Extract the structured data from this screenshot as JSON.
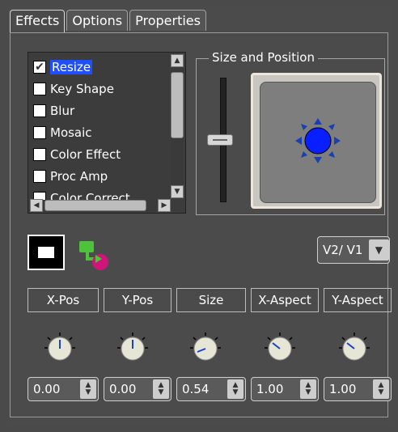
{
  "tabs": [
    {
      "label": "Effects",
      "active": true
    },
    {
      "label": "Options",
      "active": false
    },
    {
      "label": "Properties",
      "active": false
    }
  ],
  "effects": [
    {
      "label": "Resize",
      "checked": true,
      "selected": true
    },
    {
      "label": "Key Shape",
      "checked": false,
      "selected": false
    },
    {
      "label": "Blur",
      "checked": false,
      "selected": false
    },
    {
      "label": "Mosaic",
      "checked": false,
      "selected": false
    },
    {
      "label": "Color Effect",
      "checked": false,
      "selected": false
    },
    {
      "label": "Proc Amp",
      "checked": false,
      "selected": false
    },
    {
      "label": "Color Correct",
      "checked": false,
      "selected": false
    }
  ],
  "size_position": {
    "title": "Size and Position"
  },
  "layer_select": {
    "value": "V2/ V1"
  },
  "params": [
    {
      "label": "X-Pos",
      "value": "0.00"
    },
    {
      "label": "Y-Pos",
      "value": "0.00"
    },
    {
      "label": "Size",
      "value": "0.54"
    },
    {
      "label": "X-Aspect",
      "value": "1.00"
    },
    {
      "label": "Y-Aspect",
      "value": "1.00"
    }
  ],
  "icons": {
    "checkmark": "✔",
    "up": "▲",
    "down": "▼",
    "left": "◀",
    "right": "▶"
  },
  "colors": {
    "selection": "#1f4fff",
    "preview_marker": "#0a1fff",
    "swap_green": "#4ec23a",
    "swap_magenta": "#d0157a"
  }
}
